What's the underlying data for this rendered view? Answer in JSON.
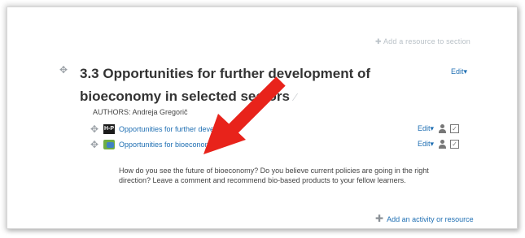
{
  "top_link": "Add a resource to section",
  "section": {
    "title": "3.3 Opportunities for further development of bioeconomy in selected sectors",
    "edit_label": "Edit",
    "authors": "AUTHORS: Andreja Gregorič"
  },
  "activities": [
    {
      "icon": "hp-page-icon",
      "icon_text": "H-P",
      "label": "Opportunities for further develop",
      "edit_label": "Edit"
    },
    {
      "icon": "forum-icon",
      "icon_text": "",
      "label": "Opportunities for bioeconomy",
      "edit_label": "Edit"
    }
  ],
  "description": "How do you see the future of bioeconomy? Do you believe current policies are going in the right direction? Leave a comment and recommend bio-based products to your fellow learners.",
  "add_resource": "Add an activity or resource",
  "colors": {
    "link": "#1f6fb3",
    "arrow": "#e8231b",
    "title": "#333333"
  }
}
